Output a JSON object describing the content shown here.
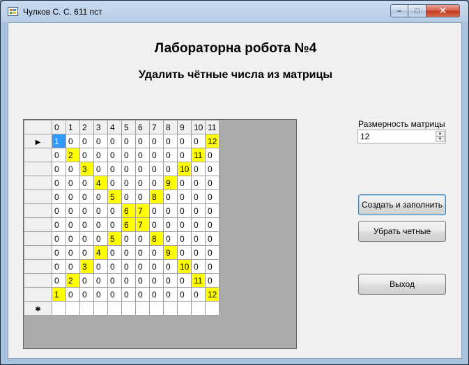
{
  "window": {
    "title": "Чулков С. С. 611 пст",
    "controls": {
      "minimize": "–",
      "maximize": "□",
      "close": "✕"
    }
  },
  "headings": {
    "title": "Лабораторна робота №4",
    "subtitle": "Удалить чётные числа из матрицы"
  },
  "grid": {
    "columns": [
      "0",
      "1",
      "2",
      "3",
      "4",
      "5",
      "6",
      "7",
      "8",
      "9",
      "10",
      "11"
    ],
    "current_row_marker": "▶",
    "new_row_marker": "✱",
    "rows": [
      [
        "1",
        "0",
        "0",
        "0",
        "0",
        "0",
        "0",
        "0",
        "0",
        "0",
        "0",
        "12"
      ],
      [
        "0",
        "2",
        "0",
        "0",
        "0",
        "0",
        "0",
        "0",
        "0",
        "0",
        "11",
        "0"
      ],
      [
        "0",
        "0",
        "3",
        "0",
        "0",
        "0",
        "0",
        "0",
        "0",
        "10",
        "0",
        "0"
      ],
      [
        "0",
        "0",
        "0",
        "4",
        "0",
        "0",
        "0",
        "0",
        "9",
        "0",
        "0",
        "0"
      ],
      [
        "0",
        "0",
        "0",
        "0",
        "5",
        "0",
        "0",
        "8",
        "0",
        "0",
        "0",
        "0"
      ],
      [
        "0",
        "0",
        "0",
        "0",
        "0",
        "6",
        "7",
        "0",
        "0",
        "0",
        "0",
        "0"
      ],
      [
        "0",
        "0",
        "0",
        "0",
        "0",
        "6",
        "7",
        "0",
        "0",
        "0",
        "0",
        "0"
      ],
      [
        "0",
        "0",
        "0",
        "0",
        "5",
        "0",
        "0",
        "8",
        "0",
        "0",
        "0",
        "0"
      ],
      [
        "0",
        "0",
        "0",
        "4",
        "0",
        "0",
        "0",
        "0",
        "9",
        "0",
        "0",
        "0"
      ],
      [
        "0",
        "0",
        "3",
        "0",
        "0",
        "0",
        "0",
        "0",
        "0",
        "10",
        "0",
        "0"
      ],
      [
        "0",
        "2",
        "0",
        "0",
        "0",
        "0",
        "0",
        "0",
        "0",
        "0",
        "11",
        "0"
      ],
      [
        "1",
        "0",
        "0",
        "0",
        "0",
        "0",
        "0",
        "0",
        "0",
        "0",
        "0",
        "12"
      ]
    ],
    "highlight_color": "#ffff00",
    "selection_color": "#3399ff"
  },
  "size_control": {
    "label": "Размерность матрицы",
    "value": "12"
  },
  "buttons": {
    "create": "Создать и заполнить",
    "remove_even": "Убрать четные",
    "exit": "Выход"
  }
}
